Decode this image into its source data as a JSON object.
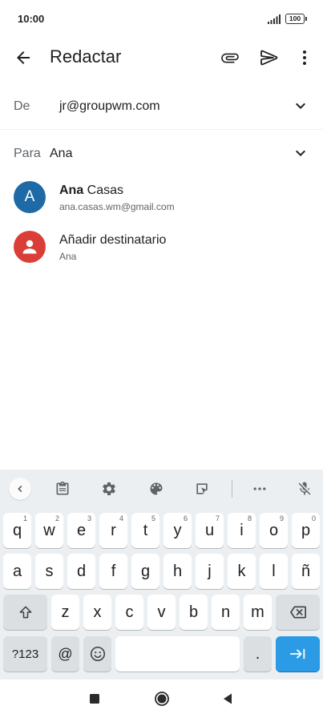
{
  "status_bar": {
    "time": "10:00",
    "battery": "100"
  },
  "app_bar": {
    "title": "Redactar"
  },
  "compose": {
    "from_label": "De",
    "from_value": "jr@groupwm.com",
    "to_label": "Para",
    "to_value": "Ana"
  },
  "suggestions": [
    {
      "initial": "A",
      "name_bold": "Ana",
      "name_rest": " Casas",
      "email": "ana.casas.wm@gmail.com",
      "avatar_color": "#1e6aa6"
    },
    {
      "name": "Añadir destinatario",
      "sub": "Ana",
      "avatar_color": "#d93f37"
    }
  ],
  "keyboard": {
    "row1": [
      {
        "key": "q",
        "hint": "1"
      },
      {
        "key": "w",
        "hint": "2"
      },
      {
        "key": "e",
        "hint": "3"
      },
      {
        "key": "r",
        "hint": "4"
      },
      {
        "key": "t",
        "hint": "5"
      },
      {
        "key": "y",
        "hint": "6"
      },
      {
        "key": "u",
        "hint": "7"
      },
      {
        "key": "i",
        "hint": "8"
      },
      {
        "key": "o",
        "hint": "9"
      },
      {
        "key": "p",
        "hint": "0"
      }
    ],
    "row2": [
      "a",
      "s",
      "d",
      "f",
      "g",
      "h",
      "j",
      "k",
      "l",
      "ñ"
    ],
    "row3": [
      "z",
      "x",
      "c",
      "v",
      "b",
      "n",
      "m"
    ],
    "symbols_label": "?123",
    "at_label": "@",
    "period_label": "."
  },
  "colors": {
    "accent": "#2b9be5",
    "keyboard_bg": "#eceff1"
  }
}
